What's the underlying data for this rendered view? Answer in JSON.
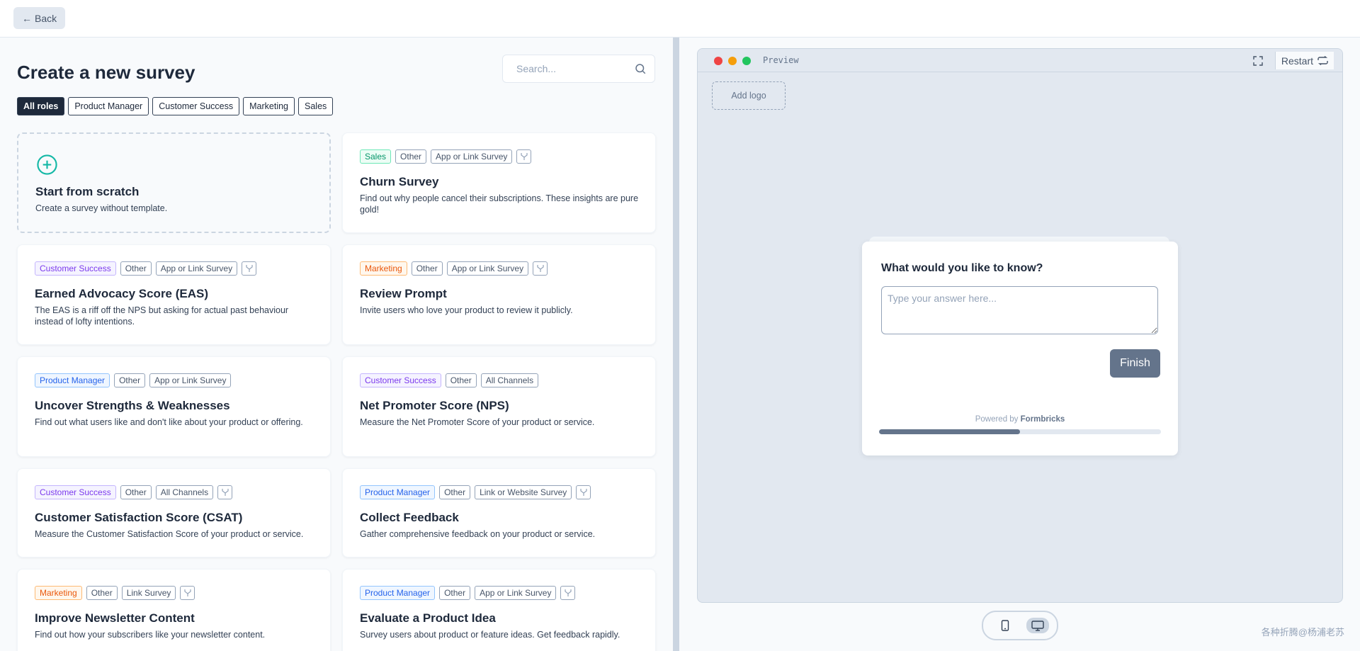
{
  "topbar": {
    "back_label": "Back"
  },
  "main": {
    "title": "Create a new survey",
    "search_placeholder": "Search...",
    "roles": [
      "All roles",
      "Product Manager",
      "Customer Success",
      "Marketing",
      "Sales"
    ],
    "scratch": {
      "title": "Start from scratch",
      "desc": "Create a survey without template."
    },
    "templates": [
      {
        "tags": [
          "Sales",
          "Other",
          "App or Link Survey"
        ],
        "title": "Churn Survey",
        "desc": "Find out why people cancel their subscriptions. These insights are pure gold!"
      },
      {
        "tags": [
          "Customer Success",
          "Other",
          "App or Link Survey"
        ],
        "title": "Earned Advocacy Score (EAS)",
        "desc": "The EAS is a riff off the NPS but asking for actual past behaviour instead of lofty intentions."
      },
      {
        "tags": [
          "Marketing",
          "Other",
          "App or Link Survey"
        ],
        "title": "Review Prompt",
        "desc": "Invite users who love your product to review it publicly."
      },
      {
        "tags": [
          "Product Manager",
          "Other",
          "App or Link Survey"
        ],
        "title": "Uncover Strengths & Weaknesses",
        "desc": "Find out what users like and don't like about your product or offering."
      },
      {
        "tags": [
          "Customer Success",
          "Other",
          "All Channels"
        ],
        "title": "Net Promoter Score (NPS)",
        "desc": "Measure the Net Promoter Score of your product or service."
      },
      {
        "tags": [
          "Customer Success",
          "Other",
          "All Channels"
        ],
        "title": "Customer Satisfaction Score (CSAT)",
        "desc": "Measure the Customer Satisfaction Score of your product or service."
      },
      {
        "tags": [
          "Product Manager",
          "Other",
          "Link or Website Survey"
        ],
        "title": "Collect Feedback",
        "desc": "Gather comprehensive feedback on your product or service."
      },
      {
        "tags": [
          "Marketing",
          "Other",
          "Link Survey"
        ],
        "title": "Improve Newsletter Content",
        "desc": "Find out how your subscribers like your newsletter content."
      },
      {
        "tags": [
          "Product Manager",
          "Other",
          "App or Link Survey"
        ],
        "title": "Evaluate a Product Idea",
        "desc": "Survey users about product or feature ideas. Get feedback rapidly."
      }
    ]
  },
  "preview": {
    "label": "Preview",
    "restart_label": "Restart",
    "add_logo": "Add logo",
    "question": "What would you like to know?",
    "answer_placeholder": "Type your answer here...",
    "finish_label": "Finish",
    "powered_by": "Powered by",
    "brand": "Formbricks",
    "progress_percent": 50
  },
  "watermark": "各种折腾@杨浦老苏",
  "colors": {
    "accent_teal": "#14b8a6",
    "slate_dark": "#1e293b",
    "finish_button": "#64748b"
  }
}
